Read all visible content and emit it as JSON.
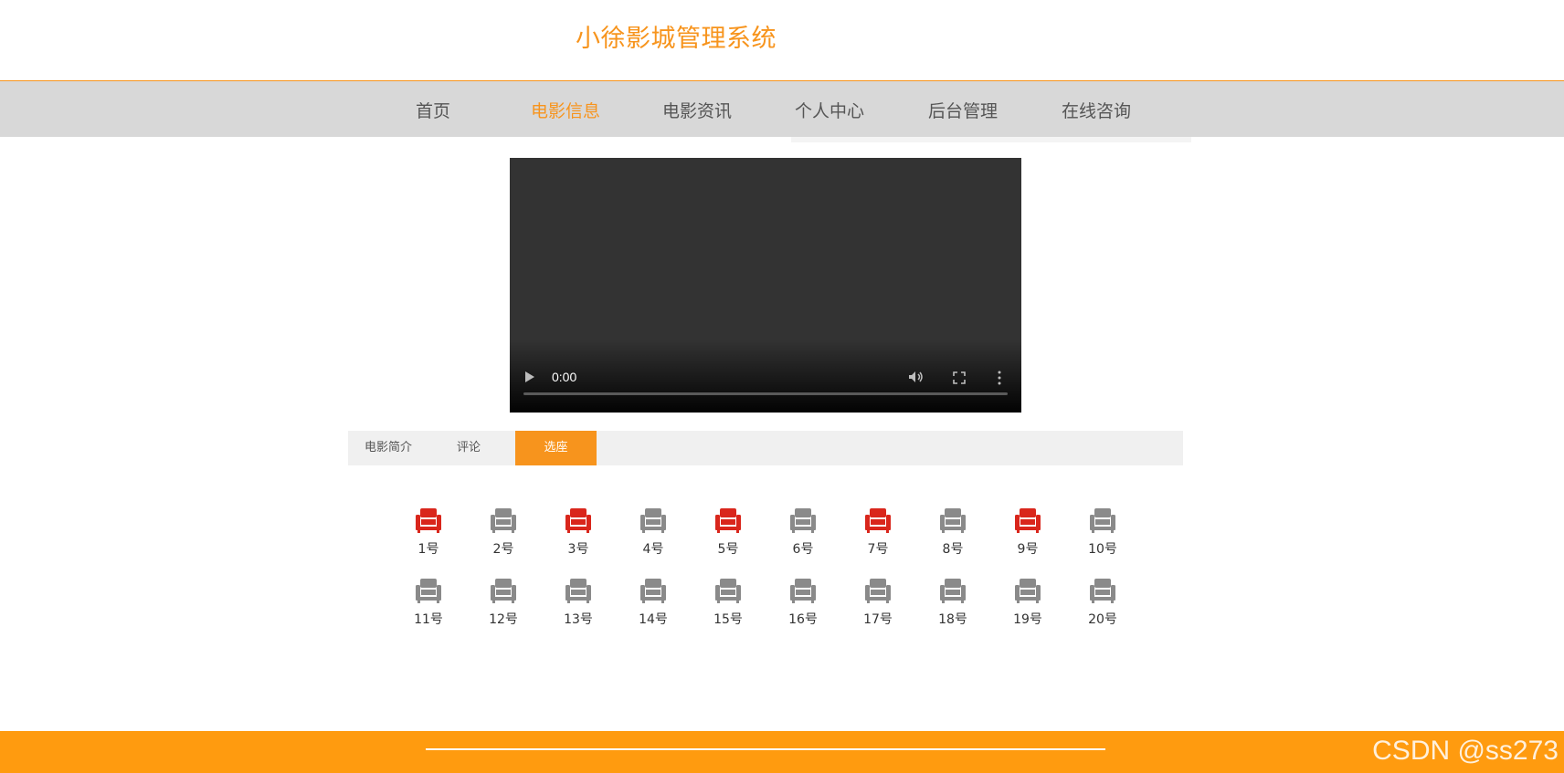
{
  "header": {
    "title": "小徐影城管理系统"
  },
  "nav": {
    "items": [
      {
        "label": "首页"
      },
      {
        "label": "电影信息"
      },
      {
        "label": "电影资讯"
      },
      {
        "label": "个人中心"
      },
      {
        "label": "后台管理"
      },
      {
        "label": "在线咨询"
      }
    ],
    "active_index": 1
  },
  "video": {
    "time": "0:00",
    "progress": 0
  },
  "tabs": {
    "items": [
      {
        "label": "电影简介"
      },
      {
        "label": "评论"
      },
      {
        "label": "选座"
      }
    ],
    "active_index": 2
  },
  "seats": {
    "status_colors": {
      "occupied": "#d9261c",
      "available": "#8a8a8a"
    },
    "rows": [
      [
        {
          "label": "1号",
          "status": "occupied"
        },
        {
          "label": "2号",
          "status": "available"
        },
        {
          "label": "3号",
          "status": "occupied"
        },
        {
          "label": "4号",
          "status": "available"
        },
        {
          "label": "5号",
          "status": "occupied"
        },
        {
          "label": "6号",
          "status": "available"
        },
        {
          "label": "7号",
          "status": "occupied"
        },
        {
          "label": "8号",
          "status": "available"
        },
        {
          "label": "9号",
          "status": "occupied"
        },
        {
          "label": "10号",
          "status": "available"
        }
      ],
      [
        {
          "label": "11号",
          "status": "available"
        },
        {
          "label": "12号",
          "status": "available"
        },
        {
          "label": "13号",
          "status": "available"
        },
        {
          "label": "14号",
          "status": "available"
        },
        {
          "label": "15号",
          "status": "available"
        },
        {
          "label": "16号",
          "status": "available"
        },
        {
          "label": "17号",
          "status": "available"
        },
        {
          "label": "18号",
          "status": "available"
        },
        {
          "label": "19号",
          "status": "available"
        },
        {
          "label": "20号",
          "status": "available"
        }
      ]
    ]
  },
  "footer": {
    "watermark": "CSDN @ss273",
    "accent": "#ff9b0f"
  },
  "theme": {
    "accent": "#f7941d",
    "nav_bg": "#d8d8d8"
  }
}
